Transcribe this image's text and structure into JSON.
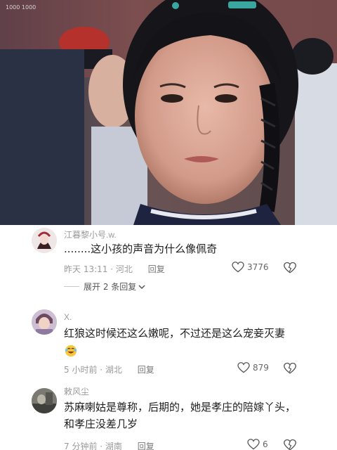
{
  "video": {
    "watermark": "1000 1000",
    "scene_description_icon": "drama-still-image"
  },
  "comments": [
    {
      "username": "江暮黎小号.w.",
      "text": "........这小孩的声音为什么像佩奇",
      "time": "昨天 13:11",
      "location": "河北",
      "reply_label": "回复",
      "likes": "3776",
      "expand_label": "展开 2 条回复",
      "avatar_icon": "anime-avatar"
    },
    {
      "username": "X.",
      "text": "红狼这时候还这么嫩呢，不过还是这么宠妾灭妻",
      "emoji": "laughing-tears-emoji",
      "time": "5 小时前",
      "location": "湖北",
      "reply_label": "回复",
      "likes": "879",
      "avatar_icon": "person-avatar"
    },
    {
      "username": "敕风尘",
      "text": "苏麻喇姑是尊称，后期的，她是孝庄的陪嫁丫头，和孝庄没差几岁",
      "time": "7 分钟前",
      "location": "湖南",
      "reply_label": "回复",
      "likes": "6",
      "avatar_icon": "photo-avatar"
    }
  ],
  "colors": {
    "accent_red": "#e03b3b",
    "meta_gray": "#9a9a9a",
    "text_dark": "#1e1e1e"
  }
}
